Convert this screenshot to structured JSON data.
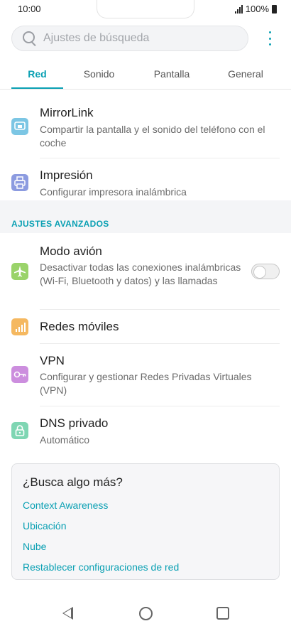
{
  "status_bar": {
    "time": "10:00",
    "battery": "100%"
  },
  "search": {
    "placeholder": "Ajustes de búsqueda"
  },
  "tabs": [
    {
      "label": "Red",
      "active": true
    },
    {
      "label": "Sonido",
      "active": false
    },
    {
      "label": "Pantalla",
      "active": false
    },
    {
      "label": "General",
      "active": false
    }
  ],
  "items": [
    {
      "title": "MirrorLink",
      "subtitle": "Compartir la pantalla y el sonido del teléfono con el coche",
      "icon": "mirrorlink-icon",
      "color": "#7cc6e4"
    },
    {
      "title": "Impresión",
      "subtitle": "Configurar impresora inalámbrica",
      "icon": "printer-icon",
      "color": "#8c9be0"
    }
  ],
  "section": {
    "header": "AJUSTES AVANZADOS"
  },
  "advanced_items": [
    {
      "title": "Modo avión",
      "subtitle": "Desactivar todas las conexiones inalámbricas (Wi-Fi, Bluetooth y datos) y las llamadas",
      "icon": "airplane-icon",
      "color": "#9ad36a",
      "toggle": "off"
    },
    {
      "title": "Redes móviles",
      "subtitle": "",
      "icon": "signal-icon",
      "color": "#f5b860"
    },
    {
      "title": "VPN",
      "subtitle": "Configurar y gestionar Redes Privadas Virtuales (VPN)",
      "icon": "key-icon",
      "color": "#cc8ede"
    },
    {
      "title": "DNS privado",
      "subtitle": "Automático",
      "icon": "lock-icon",
      "color": "#7fd6b3"
    }
  ],
  "card": {
    "title": "¿Busca algo más?",
    "links": [
      "Context Awareness",
      "Ubicación",
      "Nube",
      "Restablecer configuraciones de red"
    ]
  },
  "accent_color": "#0aa0b3"
}
